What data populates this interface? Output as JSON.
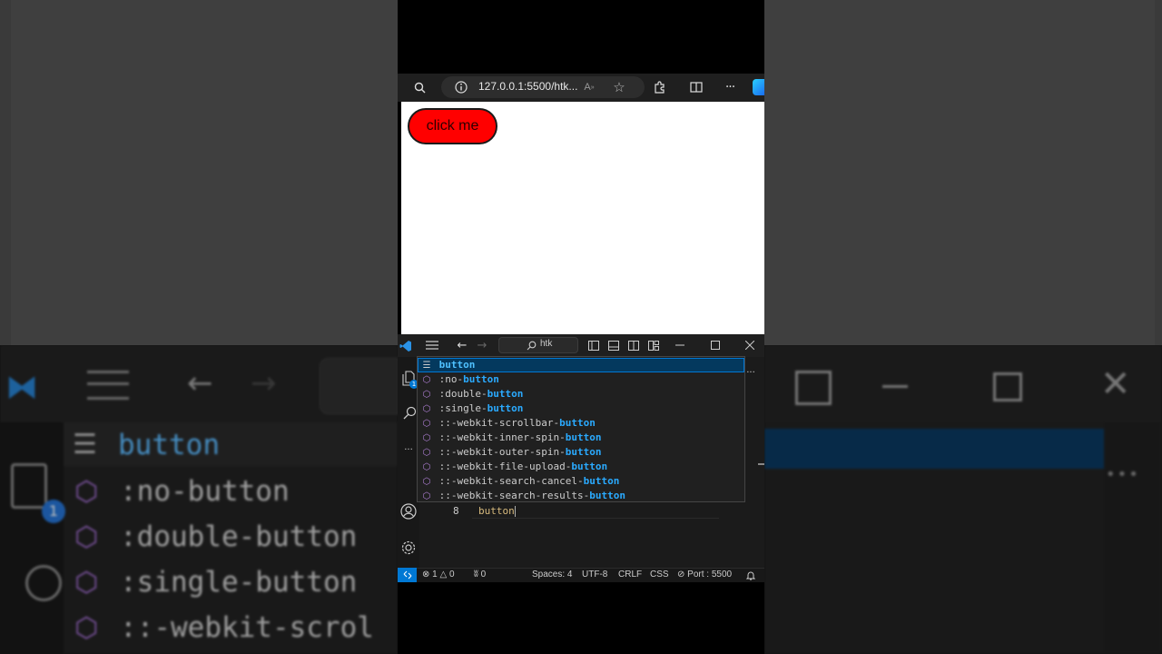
{
  "browser": {
    "url": "127.0.0.1:5500/htk...",
    "page_button_label": "click me"
  },
  "vscode": {
    "search_label": "htk",
    "suggestions": [
      {
        "prefix": "",
        "match": "button",
        "kind": "keyword",
        "selected": true
      },
      {
        "prefix": ":no-",
        "match": "button",
        "kind": "property",
        "selected": false
      },
      {
        "prefix": ":double-",
        "match": "button",
        "kind": "property",
        "selected": false
      },
      {
        "prefix": ":single-",
        "match": "button",
        "kind": "property",
        "selected": false
      },
      {
        "prefix": "::-webkit-scrollbar-",
        "match": "button",
        "kind": "property",
        "selected": false
      },
      {
        "prefix": "::-webkit-inner-spin-",
        "match": "button",
        "kind": "property",
        "selected": false
      },
      {
        "prefix": "::-webkit-outer-spin-",
        "match": "button",
        "kind": "property",
        "selected": false
      },
      {
        "prefix": "::-webkit-file-upload-",
        "match": "button",
        "kind": "property",
        "selected": false
      },
      {
        "prefix": "::-webkit-search-cancel-",
        "match": "button",
        "kind": "property",
        "selected": false
      },
      {
        "prefix": "::-webkit-search-results-",
        "match": "button",
        "kind": "property",
        "selected": false
      }
    ],
    "editor": {
      "line_number": "8",
      "line_text": "button"
    },
    "explorer_badge": "1",
    "status": {
      "errors": "1",
      "warnings": "0",
      "ports": "0",
      "spaces": "Spaces: 4",
      "encoding": "UTF-8",
      "eol": "CRLF",
      "language": "CSS",
      "port": "Port : 5500"
    }
  },
  "background": {
    "suggestion_selected": "button",
    "lines": [
      ":no-button",
      ":double-button",
      ":single-button",
      "::-webkit-scrol"
    ],
    "badge": "1"
  },
  "colors": {
    "accent": "#0078d4",
    "button_red": "#ff0000",
    "match_blue": "#2aaaff",
    "editor_bg": "#1b1b1b"
  }
}
